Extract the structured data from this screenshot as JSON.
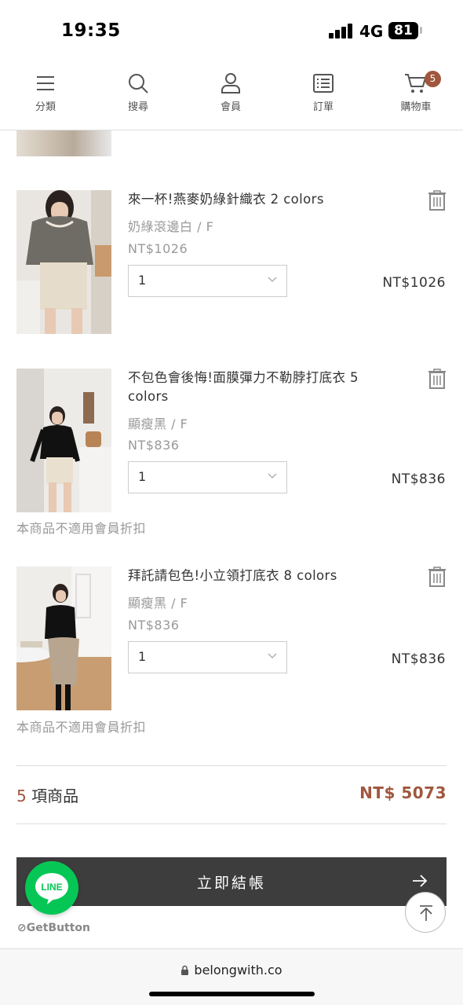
{
  "status_bar": {
    "time": "19:35",
    "network": "4G",
    "battery": "81"
  },
  "nav": {
    "items": [
      {
        "label": "分類",
        "icon": "menu-icon"
      },
      {
        "label": "搜尋",
        "icon": "search-icon"
      },
      {
        "label": "會員",
        "icon": "user-icon"
      },
      {
        "label": "訂單",
        "icon": "order-list-icon"
      },
      {
        "label": "購物車",
        "icon": "cart-icon"
      }
    ],
    "cart_count": "5"
  },
  "cart": {
    "items": [
      {
        "name": "來一杯!燕麥奶綠針織衣 2 colors",
        "variant": "奶綠滾邊白 / F",
        "price": "NT$1026",
        "quantity": "1",
        "line_total": "NT$1026",
        "note": ""
      },
      {
        "name": "不包色會後悔!面膜彈力不勒脖打底衣 5 colors",
        "variant": "顯瘦黑 / F",
        "price": "NT$836",
        "quantity": "1",
        "line_total": "NT$836",
        "note": "本商品不適用會員折扣"
      },
      {
        "name": "拜託請包色!小立領打底衣 8 colors",
        "variant": "顯瘦黑 / F",
        "price": "NT$836",
        "quantity": "1",
        "line_total": "NT$836",
        "note": "本商品不適用會員折扣"
      }
    ]
  },
  "summary": {
    "count": "5",
    "count_suffix": "項商品",
    "total": "NT$ 5073"
  },
  "checkout": {
    "label": "立即結帳"
  },
  "widgets": {
    "line_label": "LINE",
    "getbutton_label": "GetButton"
  },
  "browser": {
    "url": "belongwith.co"
  },
  "colors": {
    "accent": "#a0573e",
    "checkout_bg": "#3d3d3d",
    "line_green": "#06c755"
  }
}
